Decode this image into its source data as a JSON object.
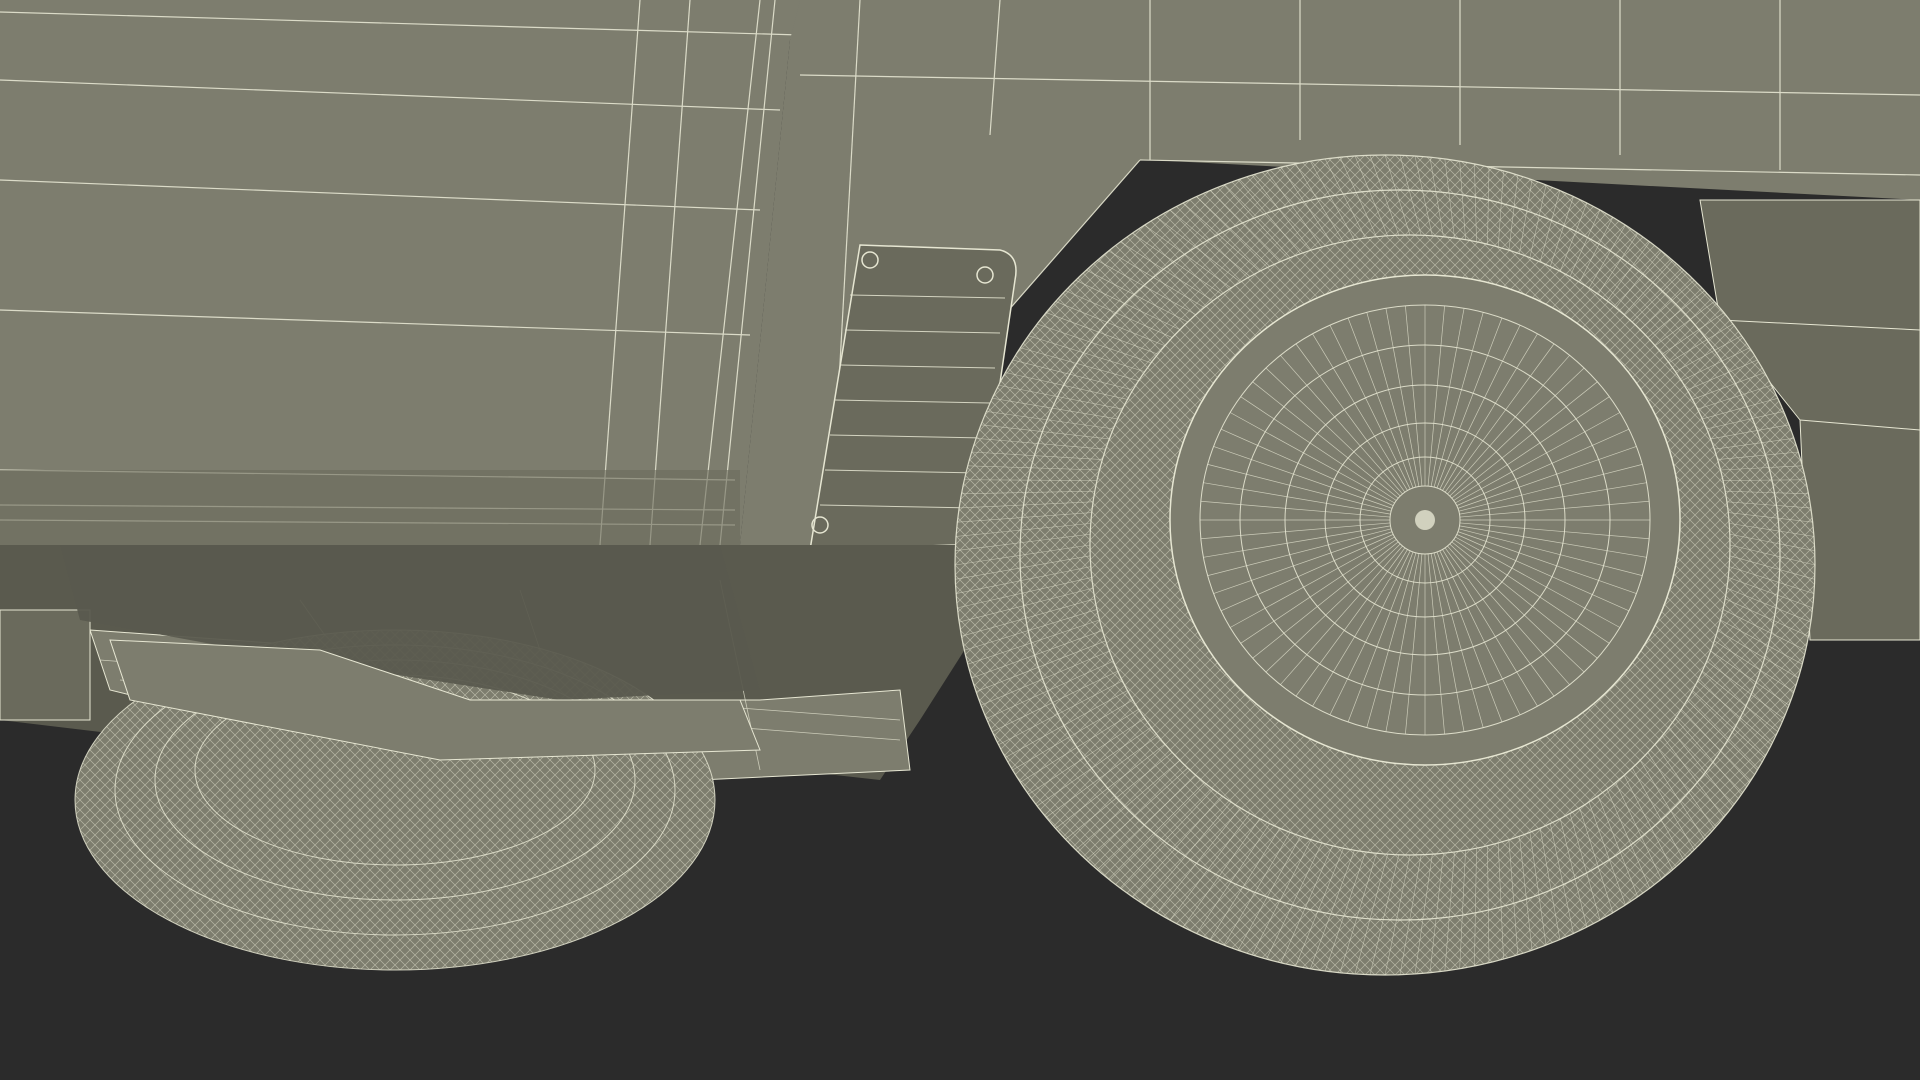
{
  "scene": {
    "subject": "wireframe-3d-render",
    "colors": {
      "background": "#2b2b2b",
      "surface": "#7d7d6e",
      "surface_dark": "#6a6a5c",
      "shadow": "#4a4a40",
      "wire": "#e6e6d2"
    }
  }
}
